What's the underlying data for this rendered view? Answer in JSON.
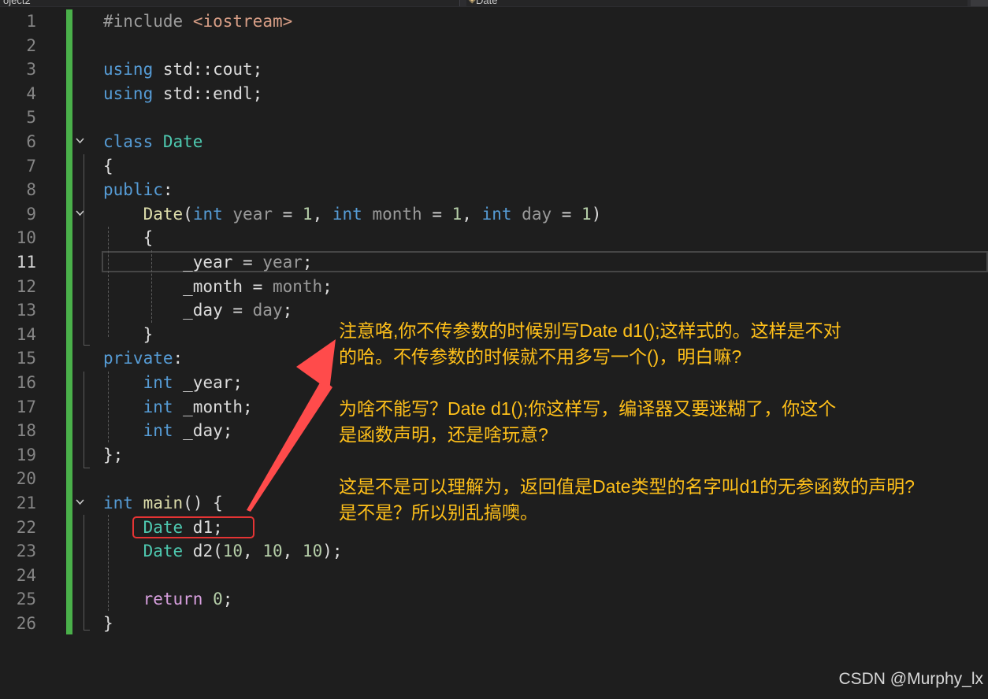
{
  "tabs": {
    "left_label": "oject2",
    "right_label": "Date"
  },
  "code_lines": [
    {
      "n": "1",
      "tokens": [
        {
          "t": "#include",
          "c": "pp"
        },
        {
          "t": " "
        },
        {
          "t": "<iostream>",
          "c": "inc"
        }
      ]
    },
    {
      "n": "2",
      "tokens": []
    },
    {
      "n": "3",
      "tokens": [
        {
          "t": "using",
          "c": "kw"
        },
        {
          "t": " std::cout;"
        }
      ]
    },
    {
      "n": "4",
      "tokens": [
        {
          "t": "using",
          "c": "kw"
        },
        {
          "t": " std::endl;"
        }
      ]
    },
    {
      "n": "5",
      "tokens": []
    },
    {
      "n": "6",
      "tokens": [
        {
          "t": "class",
          "c": "kw"
        },
        {
          "t": " "
        },
        {
          "t": "Date",
          "c": "type"
        }
      ]
    },
    {
      "n": "7",
      "tokens": [
        {
          "t": "{"
        }
      ]
    },
    {
      "n": "8",
      "tokens": [
        {
          "t": "public",
          "c": "kw"
        },
        {
          "t": ":"
        }
      ]
    },
    {
      "n": "9",
      "tokens": [
        {
          "t": "    "
        },
        {
          "t": "Date",
          "c": "fn"
        },
        {
          "t": "("
        },
        {
          "t": "int",
          "c": "kw"
        },
        {
          "t": " "
        },
        {
          "t": "year",
          "c": "param"
        },
        {
          "t": " = "
        },
        {
          "t": "1",
          "c": "num"
        },
        {
          "t": ", "
        },
        {
          "t": "int",
          "c": "kw"
        },
        {
          "t": " "
        },
        {
          "t": "month",
          "c": "param"
        },
        {
          "t": " = "
        },
        {
          "t": "1",
          "c": "num"
        },
        {
          "t": ", "
        },
        {
          "t": "int",
          "c": "kw"
        },
        {
          "t": " "
        },
        {
          "t": "day",
          "c": "param"
        },
        {
          "t": " = "
        },
        {
          "t": "1",
          "c": "num"
        },
        {
          "t": ")"
        }
      ]
    },
    {
      "n": "10",
      "tokens": [
        {
          "t": "    {"
        }
      ]
    },
    {
      "n": "11",
      "tokens": [
        {
          "t": "        _year = "
        },
        {
          "t": "year",
          "c": "param"
        },
        {
          "t": ";"
        }
      ]
    },
    {
      "n": "12",
      "tokens": [
        {
          "t": "        _month = "
        },
        {
          "t": "month",
          "c": "param"
        },
        {
          "t": ";"
        }
      ]
    },
    {
      "n": "13",
      "tokens": [
        {
          "t": "        _day = "
        },
        {
          "t": "day",
          "c": "param"
        },
        {
          "t": ";"
        }
      ]
    },
    {
      "n": "14",
      "tokens": [
        {
          "t": "    }"
        }
      ]
    },
    {
      "n": "15",
      "tokens": [
        {
          "t": "private",
          "c": "kw"
        },
        {
          "t": ":"
        }
      ]
    },
    {
      "n": "16",
      "tokens": [
        {
          "t": "    "
        },
        {
          "t": "int",
          "c": "kw"
        },
        {
          "t": " _year;"
        }
      ]
    },
    {
      "n": "17",
      "tokens": [
        {
          "t": "    "
        },
        {
          "t": "int",
          "c": "kw"
        },
        {
          "t": " _month;"
        }
      ]
    },
    {
      "n": "18",
      "tokens": [
        {
          "t": "    "
        },
        {
          "t": "int",
          "c": "kw"
        },
        {
          "t": " _day;"
        }
      ]
    },
    {
      "n": "19",
      "tokens": [
        {
          "t": "};"
        }
      ]
    },
    {
      "n": "20",
      "tokens": []
    },
    {
      "n": "21",
      "tokens": [
        {
          "t": "int",
          "c": "kw"
        },
        {
          "t": " "
        },
        {
          "t": "main",
          "c": "fn"
        },
        {
          "t": "() {"
        }
      ]
    },
    {
      "n": "22",
      "tokens": [
        {
          "t": "    "
        },
        {
          "t": "Date",
          "c": "type"
        },
        {
          "t": " d1;"
        }
      ]
    },
    {
      "n": "23",
      "tokens": [
        {
          "t": "    "
        },
        {
          "t": "Date",
          "c": "type"
        },
        {
          "t": " d2("
        },
        {
          "t": "10",
          "c": "num"
        },
        {
          "t": ", "
        },
        {
          "t": "10",
          "c": "num"
        },
        {
          "t": ", "
        },
        {
          "t": "10",
          "c": "num"
        },
        {
          "t": ");"
        }
      ]
    },
    {
      "n": "24",
      "tokens": []
    },
    {
      "n": "25",
      "tokens": [
        {
          "t": "    "
        },
        {
          "t": "return",
          "c": "ctl"
        },
        {
          "t": " "
        },
        {
          "t": "0",
          "c": "num"
        },
        {
          "t": ";"
        }
      ]
    },
    {
      "n": "26",
      "tokens": [
        {
          "t": "}"
        }
      ]
    }
  ],
  "current_line": "11",
  "fold_lines": [
    "6",
    "9",
    "21"
  ],
  "annotation": {
    "paragraphs": [
      [
        "注意咯,你不传参数的时候别写Date d1();这样式的。这样是不对",
        "的哈。不传参数的时候就不用多写一个()，明白嘛?"
      ],
      [
        "为啥不能写？Date d1();你这样写，编译器又要迷糊了，你这个",
        "是函数声明，还是啥玩意?"
      ],
      [
        "这是不是可以理解为，返回值是Date类型的名字叫d1的无参函数的声明?",
        "是不是？所以别乱搞噢。"
      ]
    ]
  },
  "watermark": "CSDN @Murphy_lx"
}
